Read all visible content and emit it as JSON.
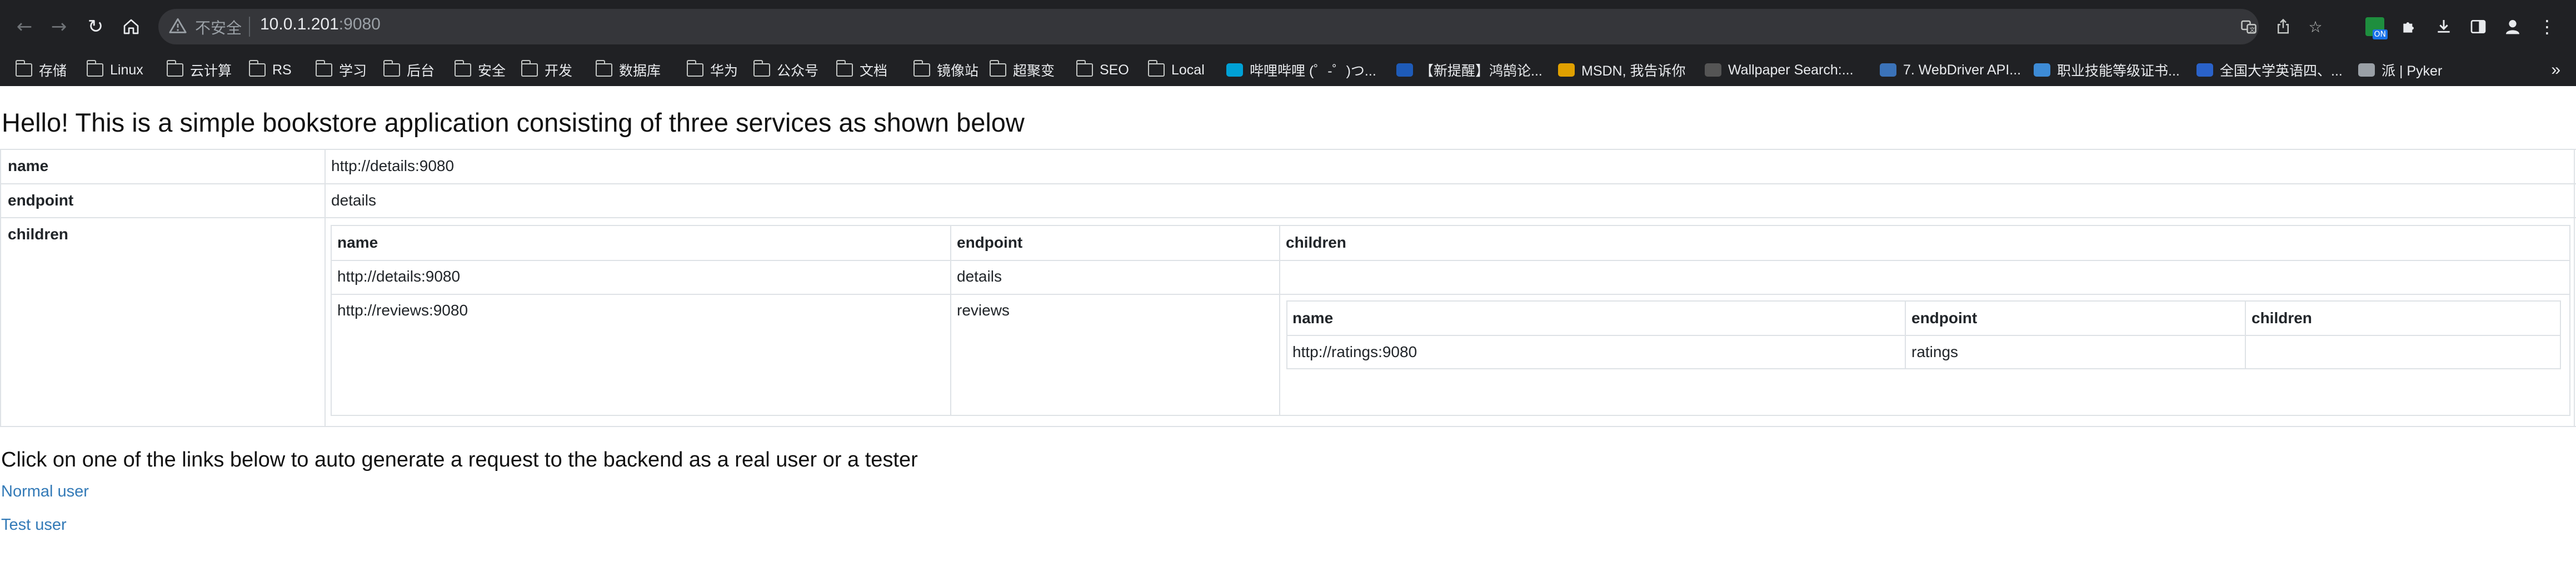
{
  "browser": {
    "address": {
      "insecure_label": "不安全",
      "host": "10.0.1.201",
      "port": ":9080"
    },
    "bookmarks": [
      {
        "label": "存储",
        "type": "folder"
      },
      {
        "label": "Linux",
        "type": "folder"
      },
      {
        "label": "云计算",
        "type": "folder"
      },
      {
        "label": "RS",
        "type": "folder"
      },
      {
        "label": "学习",
        "type": "folder"
      },
      {
        "label": "后台",
        "type": "folder"
      },
      {
        "label": "安全",
        "type": "folder"
      },
      {
        "label": "开发",
        "type": "folder"
      },
      {
        "label": "数据库",
        "type": "folder"
      },
      {
        "label": "华为",
        "type": "folder"
      },
      {
        "label": "公众号",
        "type": "folder"
      },
      {
        "label": "文档",
        "type": "folder"
      },
      {
        "label": "镜像站",
        "type": "folder"
      },
      {
        "label": "超聚变",
        "type": "folder"
      },
      {
        "label": "SEO",
        "type": "folder"
      },
      {
        "label": "Local",
        "type": "folder"
      },
      {
        "label": "哔哩哔哩 (゜-゜)つ...",
        "type": "site",
        "icon": "bilibili-icon",
        "color": "#00a1d6"
      },
      {
        "label": "【新提醒】鸿鹄论...",
        "type": "site",
        "icon": "shield-logo-icon",
        "color": "#1e5bb8"
      },
      {
        "label": "MSDN, 我告诉你",
        "type": "site",
        "icon": "msdn-icon",
        "color": "#e0a000"
      },
      {
        "label": "Wallpaper Search:...",
        "type": "site",
        "icon": "wallpaper-icon",
        "color": "#555555"
      },
      {
        "label": "7. WebDriver API...",
        "type": "site",
        "icon": "document-icon",
        "color": "#3b73b9"
      },
      {
        "label": "职业技能等级证书...",
        "type": "site",
        "icon": "binoculars-icon",
        "color": "#3d8bd6"
      },
      {
        "label": "全国大学英语四、...",
        "type": "site",
        "icon": "exam-icon",
        "color": "#2a62c9"
      },
      {
        "label": "派 | Pyker",
        "type": "site",
        "icon": "globe-icon",
        "color": "#9aa0a6"
      }
    ]
  },
  "page": {
    "heading": "Hello! This is a simple bookstore application consisting of three services as shown below",
    "outer_table": {
      "rows": [
        {
          "key": "name",
          "value": "http://details:9080"
        },
        {
          "key": "endpoint",
          "value": "details"
        },
        {
          "key": "children",
          "value": ""
        }
      ]
    },
    "children_table": {
      "headers": [
        "name",
        "endpoint",
        "children"
      ],
      "rows": [
        {
          "name": "http://details:9080",
          "endpoint": "details"
        },
        {
          "name": "http://reviews:9080",
          "endpoint": "reviews"
        }
      ]
    },
    "nested_table": {
      "headers": [
        "name",
        "endpoint",
        "children"
      ],
      "rows": [
        {
          "name": "http://ratings:9080",
          "endpoint": "ratings",
          "children": ""
        }
      ]
    },
    "subheading": "Click on one of the links below to auto generate a request to the backend as a real user or a tester",
    "links": {
      "normal_user": "Normal user",
      "test_user": "Test user"
    }
  },
  "colors": {
    "link": "#337ab7",
    "border": "#dee2e6",
    "chrome_bg": "#202124",
    "omnibox_bg": "#35363a"
  }
}
